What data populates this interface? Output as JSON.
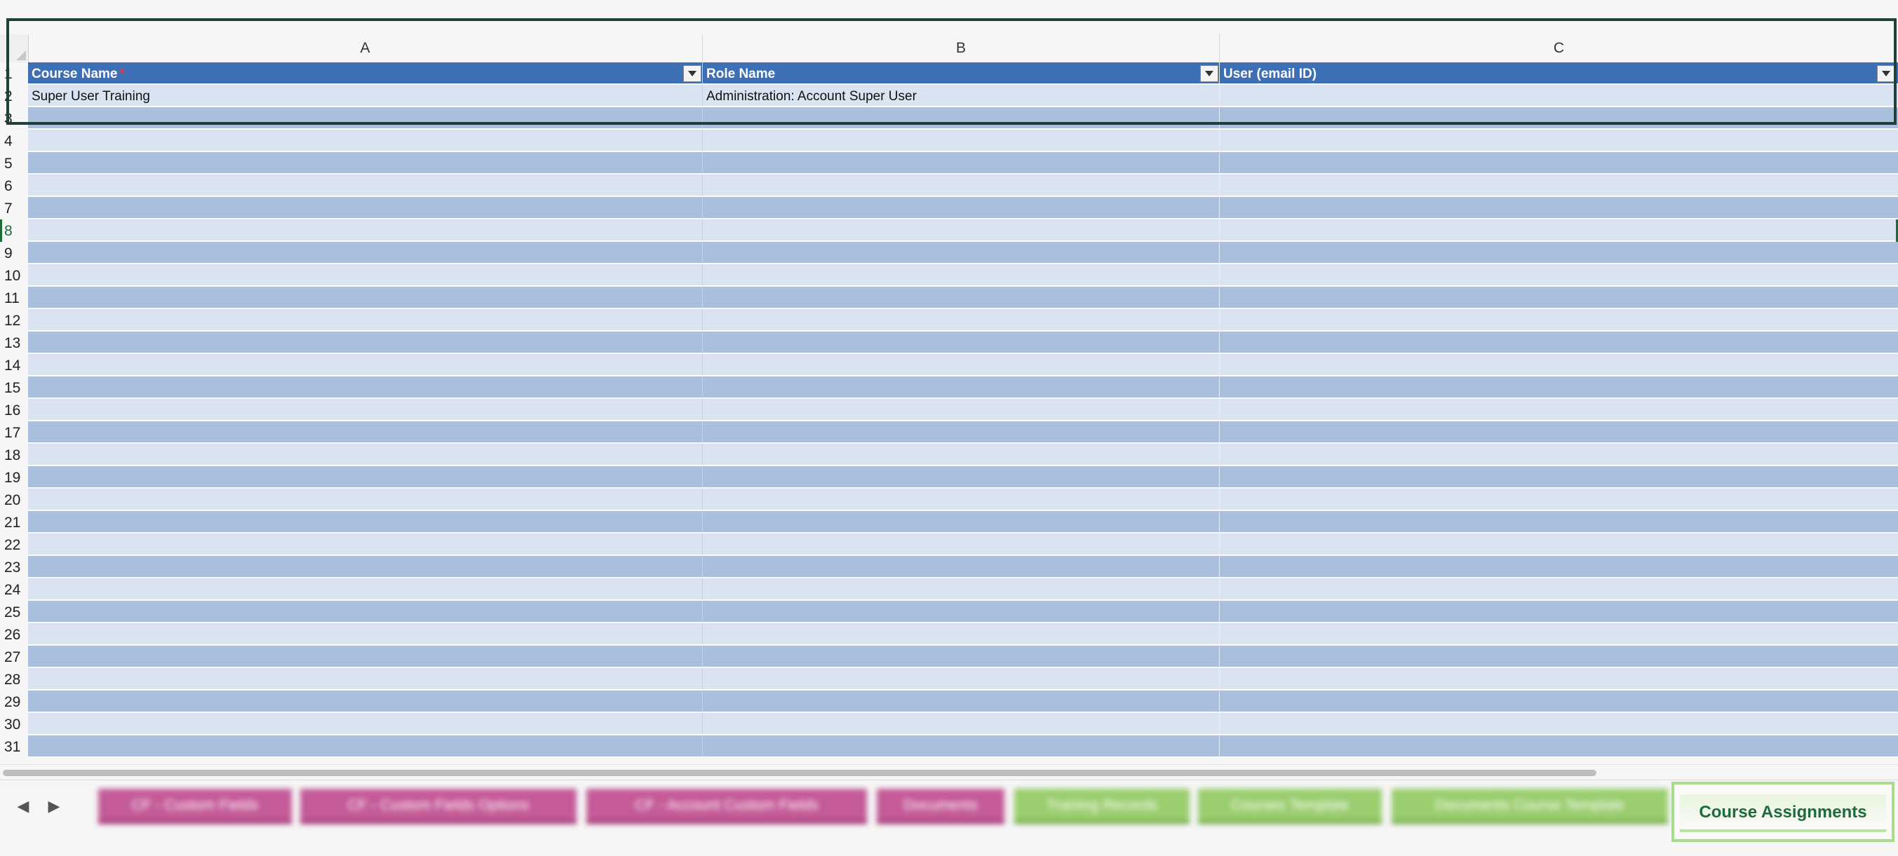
{
  "columns": [
    {
      "letter": "A",
      "header": "Course Name",
      "required": true
    },
    {
      "letter": "B",
      "header": "Role Name",
      "required": false
    },
    {
      "letter": "C",
      "header": "User (email ID)",
      "required": false
    }
  ],
  "required_marker": "*",
  "rows": [
    {
      "num": "1"
    },
    {
      "num": "2",
      "values": [
        "Super User Training",
        "Administration: Account Super User",
        ""
      ]
    },
    {
      "num": "3"
    },
    {
      "num": "4"
    },
    {
      "num": "5"
    },
    {
      "num": "6"
    },
    {
      "num": "7"
    },
    {
      "num": "8",
      "active": true
    },
    {
      "num": "9"
    },
    {
      "num": "10"
    },
    {
      "num": "11"
    },
    {
      "num": "12"
    },
    {
      "num": "13"
    },
    {
      "num": "14"
    },
    {
      "num": "15"
    },
    {
      "num": "16"
    },
    {
      "num": "17"
    },
    {
      "num": "18"
    },
    {
      "num": "19"
    },
    {
      "num": "20"
    },
    {
      "num": "21"
    },
    {
      "num": "22"
    },
    {
      "num": "23"
    },
    {
      "num": "24"
    },
    {
      "num": "25"
    },
    {
      "num": "26"
    },
    {
      "num": "27"
    },
    {
      "num": "28"
    },
    {
      "num": "29"
    },
    {
      "num": "30"
    },
    {
      "num": "31"
    }
  ],
  "sheet_tabs": [
    {
      "label": "CF - Custom Fields",
      "color": "pink",
      "blurred": true
    },
    {
      "label": "CF - Custom Fields Options",
      "color": "pink",
      "blurred": true
    },
    {
      "label": "CF - Account Custom Fields",
      "color": "pink",
      "blurred": true
    },
    {
      "label": "Documents",
      "color": "pink",
      "blurred": true
    },
    {
      "label": "Training Records",
      "color": "green",
      "blurred": true
    },
    {
      "label": "Courses Template",
      "color": "green",
      "blurred": true
    },
    {
      "label": "Documents Course Template",
      "color": "green",
      "blurred": true
    }
  ],
  "active_tab": {
    "label": "Course Assignments"
  },
  "nav": {
    "prev_icon": "triangle-left-icon",
    "next_icon": "triangle-right-icon"
  },
  "colors": {
    "header_fill": "#3d6fb4",
    "band_light": "#d9e3f1",
    "band_dark": "#a9bfdd",
    "selection": "#1f3f3a",
    "active_tab_accent": "#a6dc8a"
  }
}
